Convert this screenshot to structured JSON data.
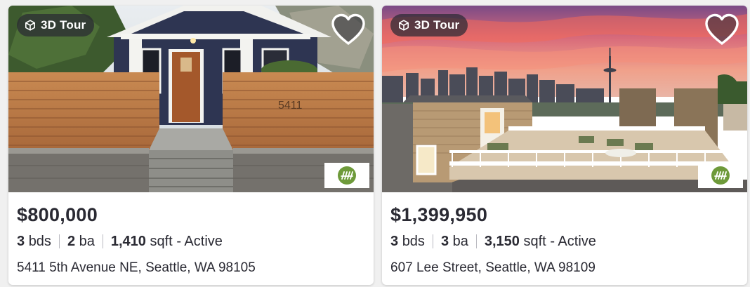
{
  "listings": [
    {
      "badge": "3D Tour",
      "price": "$800,000",
      "beds": "3",
      "beds_unit": "bds",
      "baths": "2",
      "baths_unit": "ba",
      "sqft": "1,410",
      "sqft_unit": "sqft",
      "status": "- Active",
      "address": "5411 5th Avenue NE, Seattle, WA 98105",
      "house_number_sign": "5411",
      "favorite_icon": "heart-outline-icon",
      "mls_logo_icon": "mls-logo-icon"
    },
    {
      "badge": "3D Tour",
      "price": "$1,399,950",
      "beds": "3",
      "beds_unit": "bds",
      "baths": "3",
      "baths_unit": "ba",
      "sqft": "3,150",
      "sqft_unit": "sqft",
      "status": "- Active",
      "address": "607 Lee Street, Seattle, WA 98109",
      "favorite_icon": "heart-outline-icon",
      "mls_logo_icon": "mls-logo-icon"
    }
  ],
  "colors": {
    "text": "#2a2a33",
    "badge_bg": "#2a2a33",
    "mls_green": "#6e9a3a"
  }
}
